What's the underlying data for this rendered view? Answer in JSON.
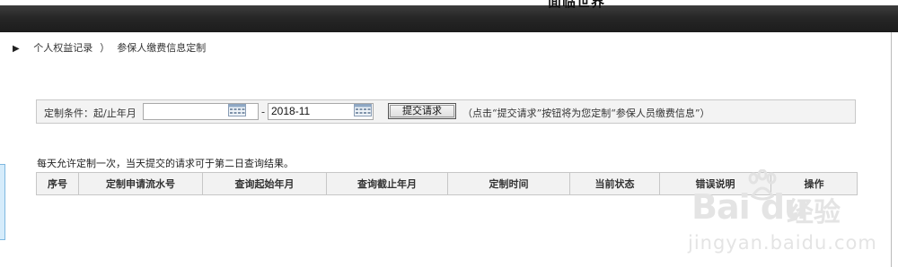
{
  "header": {
    "clipped_title": "面临世界"
  },
  "breadcrumb": {
    "marker": "▶",
    "item1": "个人权益记录",
    "separator": "）",
    "item2": "参保人缴费信息定制"
  },
  "filter": {
    "label": "定制条件：起/止年月",
    "start_value": "",
    "end_value": "2018-11",
    "dash": "-",
    "submit_label": "提交请求",
    "hint": "（点击“提交请求”按钮将为您定制“参保人员缴费信息”）"
  },
  "notice": "每天允许定制一次，当天提交的请求可于第二日查询结果。",
  "table": {
    "columns": [
      "序号",
      "定制申请流水号",
      "查询起始年月",
      "查询截止年月",
      "定制时间",
      "当前状态",
      "错误说明",
      "操作"
    ]
  },
  "watermark": {
    "brand": "Bai du",
    "cn": "经验",
    "url": "jingyan.baidu.com"
  }
}
